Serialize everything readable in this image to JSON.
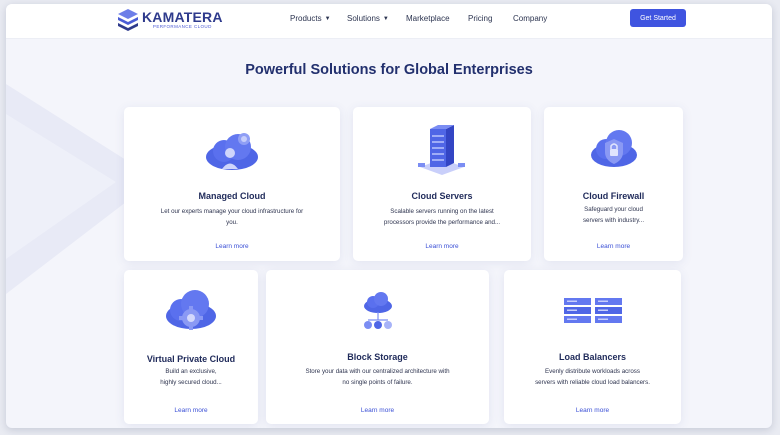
{
  "header": {
    "logo": {
      "name": "KAMATERA",
      "tagline": "PERFORMANCE CLOUD"
    },
    "nav": [
      {
        "label": "Products",
        "dropdown": true
      },
      {
        "label": "Solutions",
        "dropdown": true
      },
      {
        "label": "Marketplace",
        "dropdown": false
      },
      {
        "label": "Pricing",
        "dropdown": false
      },
      {
        "label": "Company",
        "dropdown": false
      }
    ],
    "cta_label": "Get Started"
  },
  "page_title": "Powerful Solutions for Global Enterprises",
  "cards": [
    {
      "icon": "managed-cloud-icon",
      "title": "Managed Cloud",
      "desc1": "Let our experts manage your cloud infrastructure for",
      "desc2": "you.",
      "link": "Learn more"
    },
    {
      "icon": "cloud-servers-icon",
      "title": "Cloud Servers",
      "desc1": "Scalable servers running on the latest",
      "desc2": "processors provide the performance and...",
      "link": "Learn more"
    },
    {
      "icon": "cloud-firewall-icon",
      "title": "Cloud Firewall",
      "desc1": "Safeguard your cloud",
      "desc2": "servers with industry...",
      "link": "Learn more"
    },
    {
      "icon": "virtual-private-cloud-icon",
      "title": "Virtual Private Cloud",
      "desc1": "Build an exclusive,",
      "desc2": "highly secured cloud...",
      "link": "Learn more"
    },
    {
      "icon": "block-storage-icon",
      "title": "Block Storage",
      "desc1": "Store your data with our centralized architecture with",
      "desc2": "no single points of failure.",
      "link": "Learn more"
    },
    {
      "icon": "load-balancers-icon",
      "title": "Load Balancers",
      "desc1": "Evenly distribute workloads across",
      "desc2": "servers with reliable cloud load balancers.",
      "link": "Learn more"
    }
  ],
  "colors": {
    "accent": "#3f54e0",
    "heading": "#22306e",
    "link": "#3a4fd6"
  }
}
